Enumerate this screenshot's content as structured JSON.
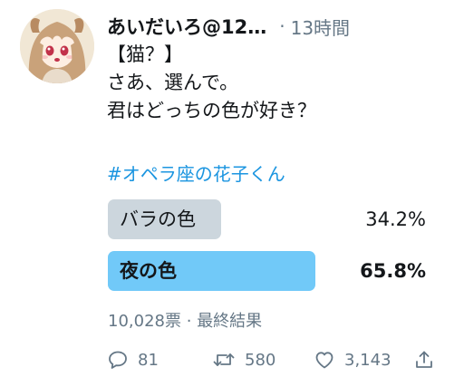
{
  "tweet": {
    "display_name": "あいだいろ@12…",
    "separator": "·",
    "timestamp": "13時間",
    "text_lines": [
      "【猫？】",
      "さあ、選んで。",
      "君はどっちの色が好き？"
    ],
    "hashtag": "#オペラ座の花子くん"
  },
  "poll": {
    "options": [
      {
        "label": "バラの色",
        "percent_text": "34.2%",
        "percent": 34.2,
        "winner": false
      },
      {
        "label": "夜の色",
        "percent_text": "65.8%",
        "percent": 65.8,
        "winner": true
      }
    ],
    "votes": "10,028票",
    "meta_separator": "·",
    "status": "最終結果"
  },
  "actions": {
    "reply_count": "81",
    "retweet_count": "580",
    "like_count": "3,143"
  },
  "colors": {
    "text": "#14171a",
    "secondary": "#657786",
    "link": "#1b95e0",
    "poll_winner": "#71c9f8",
    "poll_loser": "#ccd6dd"
  },
  "icons": [
    "reply-icon",
    "retweet-icon",
    "like-icon",
    "share-icon"
  ]
}
